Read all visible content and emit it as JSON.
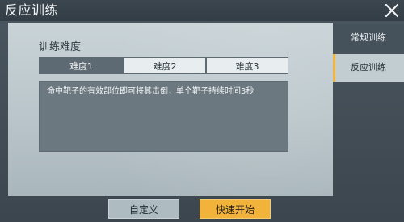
{
  "window": {
    "title": "反应训练"
  },
  "main": {
    "section_title": "训练难度",
    "difficulty_options": [
      {
        "label": "难度1",
        "selected": true
      },
      {
        "label": "难度2",
        "selected": false
      },
      {
        "label": "难度3",
        "selected": false
      }
    ],
    "description": "命中靶子的有效部位即可将其击倒，单个靶子持续时间3秒"
  },
  "tabs": [
    {
      "label": "常规训练",
      "active": false
    },
    {
      "label": "反应训练",
      "active": true
    }
  ],
  "footer": {
    "custom_label": "自定义",
    "quick_start_label": "快速开始"
  },
  "colors": {
    "accent": "#f2b33a",
    "selected_tab": "#c2cdd1",
    "unselected_tab": "#46525b"
  },
  "icons": {
    "close": "close-icon"
  }
}
